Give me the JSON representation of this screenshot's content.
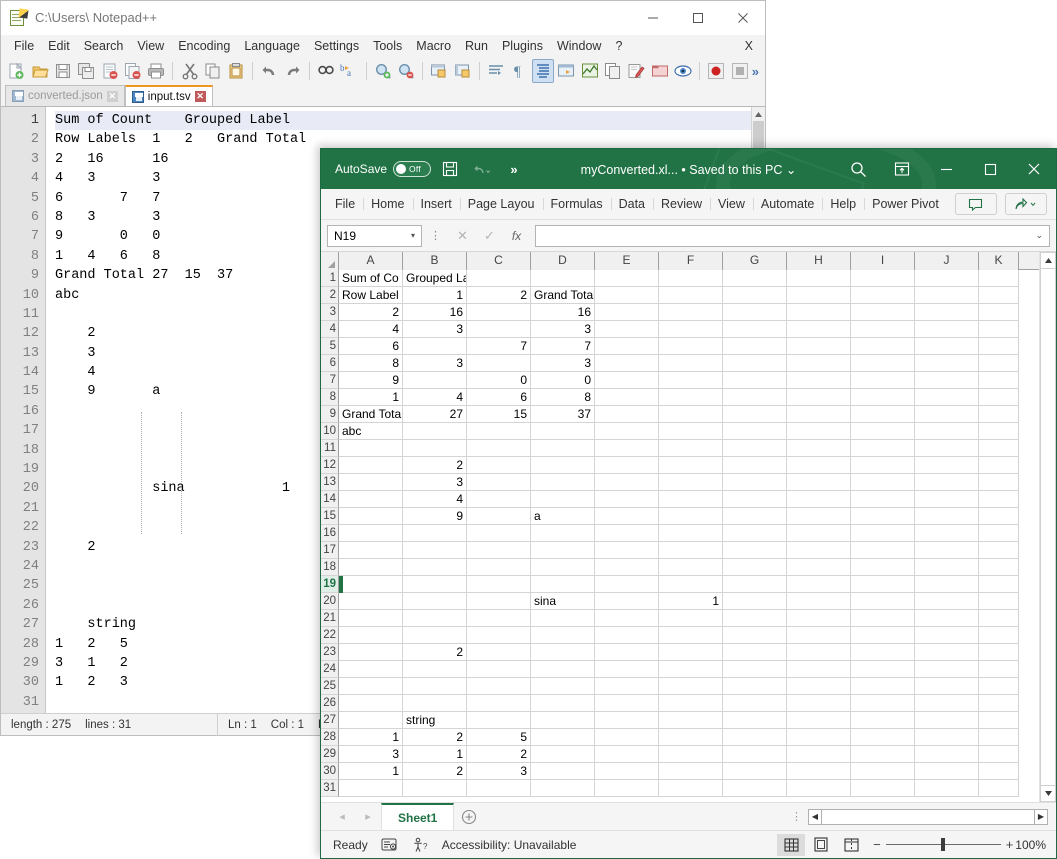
{
  "notepad": {
    "title": "C:\\Users\\ Notepad++",
    "app_icon": "notepad-plus-plus-icon",
    "window_buttons": {
      "minimize": "–",
      "maximize": "□",
      "close": "✕"
    },
    "menu": [
      "File",
      "Edit",
      "Search",
      "View",
      "Encoding",
      "Language",
      "Settings",
      "Tools",
      "Macro",
      "Run",
      "Plugins",
      "Window",
      "?"
    ],
    "menu_right": "X",
    "toolbar_icons": [
      "new-file-icon",
      "open-file-icon",
      "save-icon",
      "save-all-icon",
      "close-file-icon",
      "close-all-icon",
      "print-icon",
      "cut-icon",
      "copy-icon",
      "paste-icon",
      "undo-icon",
      "redo-icon",
      "find-icon",
      "replace-icon",
      "zoom-in-icon",
      "zoom-out-icon",
      "sync-vertical-icon",
      "sync-horizontal-icon",
      "word-wrap-icon",
      "show-all-chars-icon",
      "indent-guide-icon",
      "user-define-dialog-icon",
      "document-map-icon",
      "function-list-icon",
      "folder-as-workspace-icon",
      "document-switcher-icon",
      "monitoring-icon",
      "record-macro-icon",
      "stop-macro-icon"
    ],
    "toolbar_overflow": "»",
    "tabs": [
      {
        "label": "converted.json",
        "active": false,
        "close": "✕"
      },
      {
        "label": "input.tsv",
        "active": true,
        "close": "✕"
      }
    ],
    "lines": [
      {
        "n": 1,
        "text": "Sum of Count    Grouped Label"
      },
      {
        "n": 2,
        "text": "Row Labels  1   2   Grand Total"
      },
      {
        "n": 3,
        "text": "2   16      16"
      },
      {
        "n": 4,
        "text": "4   3       3"
      },
      {
        "n": 5,
        "text": "6       7   7"
      },
      {
        "n": 6,
        "text": "8   3       3"
      },
      {
        "n": 7,
        "text": "9       0   0"
      },
      {
        "n": 8,
        "text": "1   4   6   8"
      },
      {
        "n": 9,
        "text": "Grand Total 27  15  37"
      },
      {
        "n": 10,
        "text": "abc"
      },
      {
        "n": 11,
        "text": ""
      },
      {
        "n": 12,
        "text": "    2"
      },
      {
        "n": 13,
        "text": "    3"
      },
      {
        "n": 14,
        "text": "    4"
      },
      {
        "n": 15,
        "text": "    9       a"
      },
      {
        "n": 16,
        "text": ""
      },
      {
        "n": 17,
        "text": ""
      },
      {
        "n": 18,
        "text": ""
      },
      {
        "n": 19,
        "text": ""
      },
      {
        "n": 20,
        "text": "            sina            1"
      },
      {
        "n": 21,
        "text": ""
      },
      {
        "n": 22,
        "text": ""
      },
      {
        "n": 23,
        "text": "    2"
      },
      {
        "n": 24,
        "text": ""
      },
      {
        "n": 25,
        "text": ""
      },
      {
        "n": 26,
        "text": ""
      },
      {
        "n": 27,
        "text": "    string"
      },
      {
        "n": 28,
        "text": "1   2   5"
      },
      {
        "n": 29,
        "text": "3   1   2"
      },
      {
        "n": 30,
        "text": "1   2   3"
      },
      {
        "n": 31,
        "text": ""
      }
    ],
    "status": {
      "length_label": "length : 275",
      "lines_label": "lines : 31",
      "ln": "Ln : 1",
      "col": "Col : 1",
      "pos": "Po"
    }
  },
  "excel": {
    "autosave_label": "AutoSave",
    "autosave_state": "Off",
    "qat": [
      "save-icon",
      "undo-icon",
      "more-commands-icon"
    ],
    "qat_overflow": "»",
    "document_name": "myConverted.xl...",
    "save_state": " • Saved to this PC ",
    "save_state_caret": "⌄",
    "title_buttons": [
      "search-icon",
      "ribbon-display-options-icon",
      "minimize",
      "maximize",
      "close"
    ],
    "ribbon_tabs": [
      "File",
      "Home",
      "Insert",
      "Page Layou",
      "Formulas",
      "Data",
      "Review",
      "View",
      "Automate",
      "Help",
      "Power Pivot"
    ],
    "ribbon_right_buttons": [
      "comments-icon",
      "share-icon"
    ],
    "name_box": "N19",
    "name_box_caret": "▾",
    "formula_cancel": "✕",
    "formula_enter": "✓",
    "formula_fx": "fx",
    "formula_value": "",
    "formula_expand_caret": "⌄",
    "columns": [
      "A",
      "B",
      "C",
      "D",
      "E",
      "F",
      "G",
      "H",
      "I",
      "J",
      "K"
    ],
    "selected_cell": "N19",
    "selected_row": 19,
    "rows": [
      {
        "n": 1,
        "cells": {
          "A": "Sum of Co",
          "B": "Grouped Label"
        },
        "align": {
          "A": "left",
          "B": "left"
        }
      },
      {
        "n": 2,
        "cells": {
          "A": "Row Label",
          "B": "1",
          "C": "2",
          "D": "Grand Total"
        },
        "align": {
          "A": "left",
          "B": "right",
          "C": "right",
          "D": "left"
        }
      },
      {
        "n": 3,
        "cells": {
          "A": "2",
          "B": "16",
          "D": "16"
        },
        "align": {
          "A": "right",
          "B": "right",
          "D": "right"
        }
      },
      {
        "n": 4,
        "cells": {
          "A": "4",
          "B": "3",
          "D": "3"
        },
        "align": {
          "A": "right",
          "B": "right",
          "D": "right"
        }
      },
      {
        "n": 5,
        "cells": {
          "A": "6",
          "C": "7",
          "D": "7"
        },
        "align": {
          "A": "right",
          "C": "right",
          "D": "right"
        }
      },
      {
        "n": 6,
        "cells": {
          "A": "8",
          "B": "3",
          "D": "3"
        },
        "align": {
          "A": "right",
          "B": "right",
          "D": "right"
        }
      },
      {
        "n": 7,
        "cells": {
          "A": "9",
          "C": "0",
          "D": "0"
        },
        "align": {
          "A": "right",
          "C": "right",
          "D": "right"
        }
      },
      {
        "n": 8,
        "cells": {
          "A": "1",
          "B": "4",
          "C": "6",
          "D": "8"
        },
        "align": {
          "A": "right",
          "B": "right",
          "C": "right",
          "D": "right"
        }
      },
      {
        "n": 9,
        "cells": {
          "A": "Grand Tota",
          "B": "27",
          "C": "15",
          "D": "37"
        },
        "align": {
          "A": "left",
          "B": "right",
          "C": "right",
          "D": "right"
        }
      },
      {
        "n": 10,
        "cells": {
          "A": "abc"
        },
        "align": {
          "A": "left"
        }
      },
      {
        "n": 11,
        "cells": {},
        "align": {}
      },
      {
        "n": 12,
        "cells": {
          "B": "2"
        },
        "align": {
          "B": "right"
        }
      },
      {
        "n": 13,
        "cells": {
          "B": "3"
        },
        "align": {
          "B": "right"
        }
      },
      {
        "n": 14,
        "cells": {
          "B": "4"
        },
        "align": {
          "B": "right"
        }
      },
      {
        "n": 15,
        "cells": {
          "B": "9",
          "D": "a"
        },
        "align": {
          "B": "right",
          "D": "left"
        }
      },
      {
        "n": 16,
        "cells": {},
        "align": {}
      },
      {
        "n": 17,
        "cells": {},
        "align": {}
      },
      {
        "n": 18,
        "cells": {},
        "align": {}
      },
      {
        "n": 19,
        "cells": {},
        "align": {}
      },
      {
        "n": 20,
        "cells": {
          "D": "sina",
          "F": "1"
        },
        "align": {
          "D": "left",
          "F": "right"
        }
      },
      {
        "n": 21,
        "cells": {},
        "align": {}
      },
      {
        "n": 22,
        "cells": {},
        "align": {}
      },
      {
        "n": 23,
        "cells": {
          "B": "2"
        },
        "align": {
          "B": "right"
        }
      },
      {
        "n": 24,
        "cells": {},
        "align": {}
      },
      {
        "n": 25,
        "cells": {},
        "align": {}
      },
      {
        "n": 26,
        "cells": {},
        "align": {}
      },
      {
        "n": 27,
        "cells": {
          "B": "string"
        },
        "align": {
          "B": "left"
        }
      },
      {
        "n": 28,
        "cells": {
          "A": "1",
          "B": "2",
          "C": "5"
        },
        "align": {
          "A": "right",
          "B": "right",
          "C": "right"
        }
      },
      {
        "n": 29,
        "cells": {
          "A": "3",
          "B": "1",
          "C": "2"
        },
        "align": {
          "A": "right",
          "B": "right",
          "C": "right"
        }
      },
      {
        "n": 30,
        "cells": {
          "A": "1",
          "B": "2",
          "C": "3"
        },
        "align": {
          "A": "right",
          "B": "right",
          "C": "right"
        }
      },
      {
        "n": 31,
        "cells": {},
        "align": {}
      }
    ],
    "sheet_tabs": [
      "Sheet1"
    ],
    "add_sheet": "＋",
    "nav_prev": "◂",
    "nav_next": "▸",
    "status": {
      "ready": "Ready",
      "macro_icon": "record-macro-icon",
      "accessibility": "Accessibility: Unavailable",
      "views": [
        "normal-view-icon",
        "page-layout-view-icon",
        "page-break-view-icon"
      ],
      "zoom_out": "−",
      "zoom_in": "+",
      "zoom_level": "100%"
    }
  },
  "colors": {
    "excel_green": "#217346",
    "npp_tab_accent": "#f0961e",
    "grid_line": "#d4d4d4"
  }
}
